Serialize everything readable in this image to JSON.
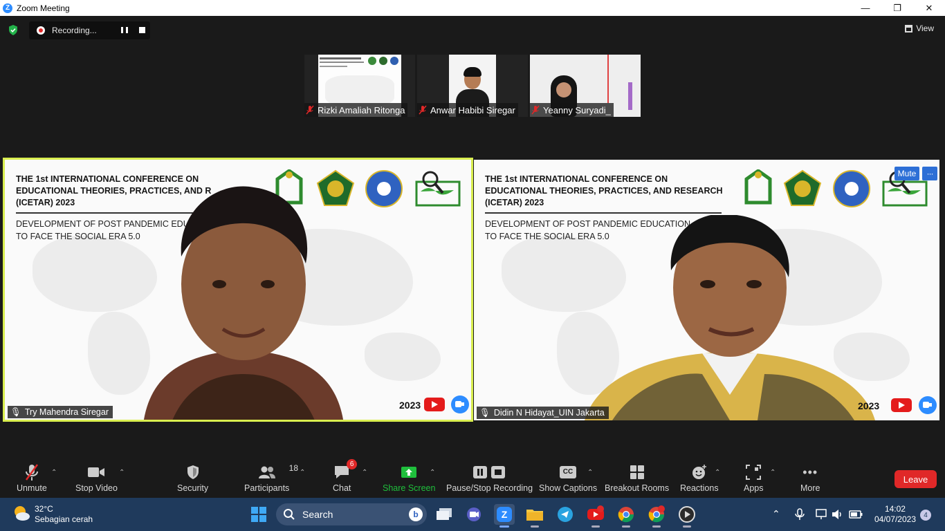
{
  "window": {
    "title": "Zoom Meeting"
  },
  "recording": {
    "label": "Recording..."
  },
  "view": {
    "label": "View"
  },
  "thumbnails": [
    {
      "name": "Rizki Amaliah Ritonga"
    },
    {
      "name": "Anwar Habibi Siregar"
    },
    {
      "name": "Yeanny Suryadi_"
    }
  ],
  "tiles": [
    {
      "name": "Try Mahendra Siregar",
      "slide_title": "THE 1st INTERNATIONAL CONFERENCE ON\nEDUCATIONAL THEORIES, PRACTICES, AND R\n(ICETAR) 2023",
      "slide_sub": "DEVELOPMENT OF POST PANDEMIC EDUC\nTO FACE THE SOCIAL ERA 5.0",
      "year": "2023"
    },
    {
      "name": "Didin N Hidayat_UIN Jakarta",
      "slide_title": "THE 1st INTERNATIONAL CONFERENCE ON\nEDUCATIONAL THEORIES, PRACTICES, AND RESEARCH\n(ICETAR) 2023",
      "slide_sub": "DEVELOPMENT OF POST PANDEMIC EDUCATION\nTO FACE THE SOCIAL ERA 5.0",
      "year": "2023",
      "mute_label": "Mute",
      "more_label": "···"
    }
  ],
  "toolbar": {
    "unmute": "Unmute",
    "stop_video": "Stop Video",
    "security": "Security",
    "participants": "Participants",
    "participants_count": "18",
    "chat": "Chat",
    "chat_badge": "6",
    "share_screen": "Share Screen",
    "pause_stop_recording": "Pause/Stop Recording",
    "show_captions": "Show Captions",
    "cc": "CC",
    "breakout_rooms": "Breakout Rooms",
    "reactions": "Reactions",
    "apps": "Apps",
    "more": "More",
    "leave": "Leave"
  },
  "taskbar": {
    "temperature": "32°C",
    "weather_desc": "Sebagian cerah",
    "search": "Search",
    "time": "14:02",
    "date": "04/07/2023",
    "notifications": "4"
  },
  "colors": {
    "accent": "#2d8cff",
    "active_speaker": "#d9ee4f",
    "leave": "#e02828",
    "share": "#1fbf3c",
    "taskbar": "#1f3a5c"
  }
}
